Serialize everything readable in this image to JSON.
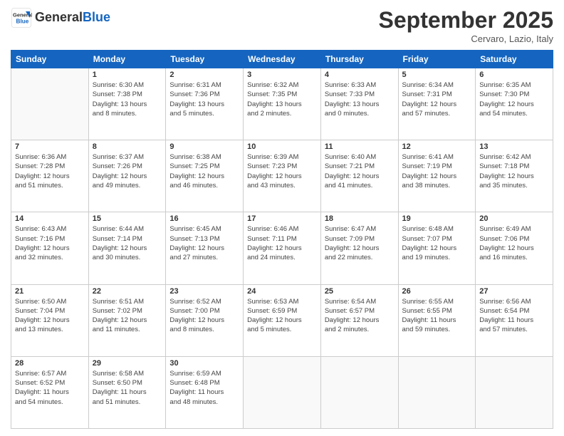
{
  "logo": {
    "general": "General",
    "blue": "Blue"
  },
  "title": "September 2025",
  "location": "Cervaro, Lazio, Italy",
  "days_of_week": [
    "Sunday",
    "Monday",
    "Tuesday",
    "Wednesday",
    "Thursday",
    "Friday",
    "Saturday"
  ],
  "weeks": [
    [
      {
        "day": "",
        "info": ""
      },
      {
        "day": "1",
        "info": "Sunrise: 6:30 AM\nSunset: 7:38 PM\nDaylight: 13 hours\nand 8 minutes."
      },
      {
        "day": "2",
        "info": "Sunrise: 6:31 AM\nSunset: 7:36 PM\nDaylight: 13 hours\nand 5 minutes."
      },
      {
        "day": "3",
        "info": "Sunrise: 6:32 AM\nSunset: 7:35 PM\nDaylight: 13 hours\nand 2 minutes."
      },
      {
        "day": "4",
        "info": "Sunrise: 6:33 AM\nSunset: 7:33 PM\nDaylight: 13 hours\nand 0 minutes."
      },
      {
        "day": "5",
        "info": "Sunrise: 6:34 AM\nSunset: 7:31 PM\nDaylight: 12 hours\nand 57 minutes."
      },
      {
        "day": "6",
        "info": "Sunrise: 6:35 AM\nSunset: 7:30 PM\nDaylight: 12 hours\nand 54 minutes."
      }
    ],
    [
      {
        "day": "7",
        "info": "Sunrise: 6:36 AM\nSunset: 7:28 PM\nDaylight: 12 hours\nand 51 minutes."
      },
      {
        "day": "8",
        "info": "Sunrise: 6:37 AM\nSunset: 7:26 PM\nDaylight: 12 hours\nand 49 minutes."
      },
      {
        "day": "9",
        "info": "Sunrise: 6:38 AM\nSunset: 7:25 PM\nDaylight: 12 hours\nand 46 minutes."
      },
      {
        "day": "10",
        "info": "Sunrise: 6:39 AM\nSunset: 7:23 PM\nDaylight: 12 hours\nand 43 minutes."
      },
      {
        "day": "11",
        "info": "Sunrise: 6:40 AM\nSunset: 7:21 PM\nDaylight: 12 hours\nand 41 minutes."
      },
      {
        "day": "12",
        "info": "Sunrise: 6:41 AM\nSunset: 7:19 PM\nDaylight: 12 hours\nand 38 minutes."
      },
      {
        "day": "13",
        "info": "Sunrise: 6:42 AM\nSunset: 7:18 PM\nDaylight: 12 hours\nand 35 minutes."
      }
    ],
    [
      {
        "day": "14",
        "info": "Sunrise: 6:43 AM\nSunset: 7:16 PM\nDaylight: 12 hours\nand 32 minutes."
      },
      {
        "day": "15",
        "info": "Sunrise: 6:44 AM\nSunset: 7:14 PM\nDaylight: 12 hours\nand 30 minutes."
      },
      {
        "day": "16",
        "info": "Sunrise: 6:45 AM\nSunset: 7:13 PM\nDaylight: 12 hours\nand 27 minutes."
      },
      {
        "day": "17",
        "info": "Sunrise: 6:46 AM\nSunset: 7:11 PM\nDaylight: 12 hours\nand 24 minutes."
      },
      {
        "day": "18",
        "info": "Sunrise: 6:47 AM\nSunset: 7:09 PM\nDaylight: 12 hours\nand 22 minutes."
      },
      {
        "day": "19",
        "info": "Sunrise: 6:48 AM\nSunset: 7:07 PM\nDaylight: 12 hours\nand 19 minutes."
      },
      {
        "day": "20",
        "info": "Sunrise: 6:49 AM\nSunset: 7:06 PM\nDaylight: 12 hours\nand 16 minutes."
      }
    ],
    [
      {
        "day": "21",
        "info": "Sunrise: 6:50 AM\nSunset: 7:04 PM\nDaylight: 12 hours\nand 13 minutes."
      },
      {
        "day": "22",
        "info": "Sunrise: 6:51 AM\nSunset: 7:02 PM\nDaylight: 12 hours\nand 11 minutes."
      },
      {
        "day": "23",
        "info": "Sunrise: 6:52 AM\nSunset: 7:00 PM\nDaylight: 12 hours\nand 8 minutes."
      },
      {
        "day": "24",
        "info": "Sunrise: 6:53 AM\nSunset: 6:59 PM\nDaylight: 12 hours\nand 5 minutes."
      },
      {
        "day": "25",
        "info": "Sunrise: 6:54 AM\nSunset: 6:57 PM\nDaylight: 12 hours\nand 2 minutes."
      },
      {
        "day": "26",
        "info": "Sunrise: 6:55 AM\nSunset: 6:55 PM\nDaylight: 11 hours\nand 59 minutes."
      },
      {
        "day": "27",
        "info": "Sunrise: 6:56 AM\nSunset: 6:54 PM\nDaylight: 11 hours\nand 57 minutes."
      }
    ],
    [
      {
        "day": "28",
        "info": "Sunrise: 6:57 AM\nSunset: 6:52 PM\nDaylight: 11 hours\nand 54 minutes."
      },
      {
        "day": "29",
        "info": "Sunrise: 6:58 AM\nSunset: 6:50 PM\nDaylight: 11 hours\nand 51 minutes."
      },
      {
        "day": "30",
        "info": "Sunrise: 6:59 AM\nSunset: 6:48 PM\nDaylight: 11 hours\nand 48 minutes."
      },
      {
        "day": "",
        "info": ""
      },
      {
        "day": "",
        "info": ""
      },
      {
        "day": "",
        "info": ""
      },
      {
        "day": "",
        "info": ""
      }
    ]
  ]
}
